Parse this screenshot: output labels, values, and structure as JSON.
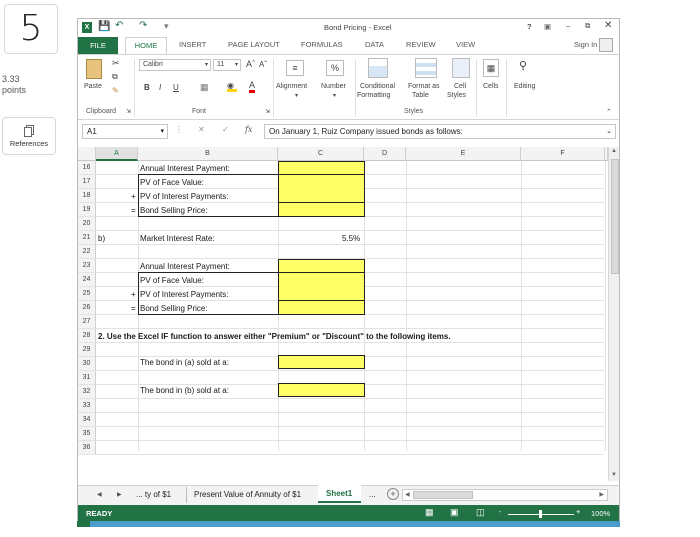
{
  "question": {
    "number": "5",
    "points": "3.33",
    "points_label": "points",
    "references_label": "References"
  },
  "window": {
    "title": "Bond Pricing - Excel",
    "help": "?",
    "sign_in": "Sign In"
  },
  "ribbon_tabs": [
    "FILE",
    "HOME",
    "INSERT",
    "PAGE LAYOUT",
    "FORMULAS",
    "DATA",
    "REVIEW",
    "VIEW"
  ],
  "ribbon": {
    "paste": "Paste",
    "clipboard": "Clipboard",
    "font_name": "Calibri",
    "font_size": "11",
    "font_group": "Font",
    "bold": "B",
    "italic": "I",
    "underline": "U",
    "alignment": "Alignment",
    "number": "Number",
    "conditional": "Conditional",
    "formatting": "Formatting",
    "format_as": "Format as",
    "table": "Table",
    "cell_styles_1": "Cell",
    "cell_styles_2": "Styles",
    "styles": "Styles",
    "cells": "Cells",
    "editing": "Editing"
  },
  "formula_bar": {
    "name_box": "A1",
    "fx": "fx",
    "content": "On January 1,  Ruiz Company issued bonds as follows:"
  },
  "columns": [
    "A",
    "B",
    "C",
    "D",
    "E",
    "F"
  ],
  "rows": [
    "16",
    "17",
    "18",
    "19",
    "20",
    "21",
    "22",
    "23",
    "24",
    "25",
    "26",
    "27",
    "28",
    "29",
    "30",
    "31",
    "32",
    "33",
    "34",
    "35",
    "36"
  ],
  "cells": {
    "r16b": "Annual Interest Payment:",
    "r17b": "PV of Face Value:",
    "r18op": "+",
    "r18b": "PV of Interest Payments:",
    "r19op": "=",
    "r19b": "Bond Selling Price:",
    "r21a": "b)",
    "r21b": "Market Interest Rate:",
    "r21c": "5.5%",
    "r23b": "Annual Interest Payment:",
    "r24b": "PV of Face Value:",
    "r25op": "+",
    "r25b": "PV of Interest Payments:",
    "r26op": "=",
    "r26b": "Bond Selling Price:",
    "r28a": "2. Use the Excel IF function to answer either \"Premium\" or \"Discount\" to the following items.",
    "r30b": "The bond in (a) sold at a:",
    "r32b": "The bond in (b) sold at a:"
  },
  "sheet_tabs": {
    "prev": "◀",
    "next": "▶",
    "tab1": "... ty of $1",
    "tab2": "Present Value of Annuity of $1",
    "tab3": "Sheet1",
    "more": "..."
  },
  "status": {
    "ready": "READY",
    "zoom": "100%"
  },
  "colors": {
    "excel_green": "#217346",
    "highlight": "#ffff66"
  }
}
